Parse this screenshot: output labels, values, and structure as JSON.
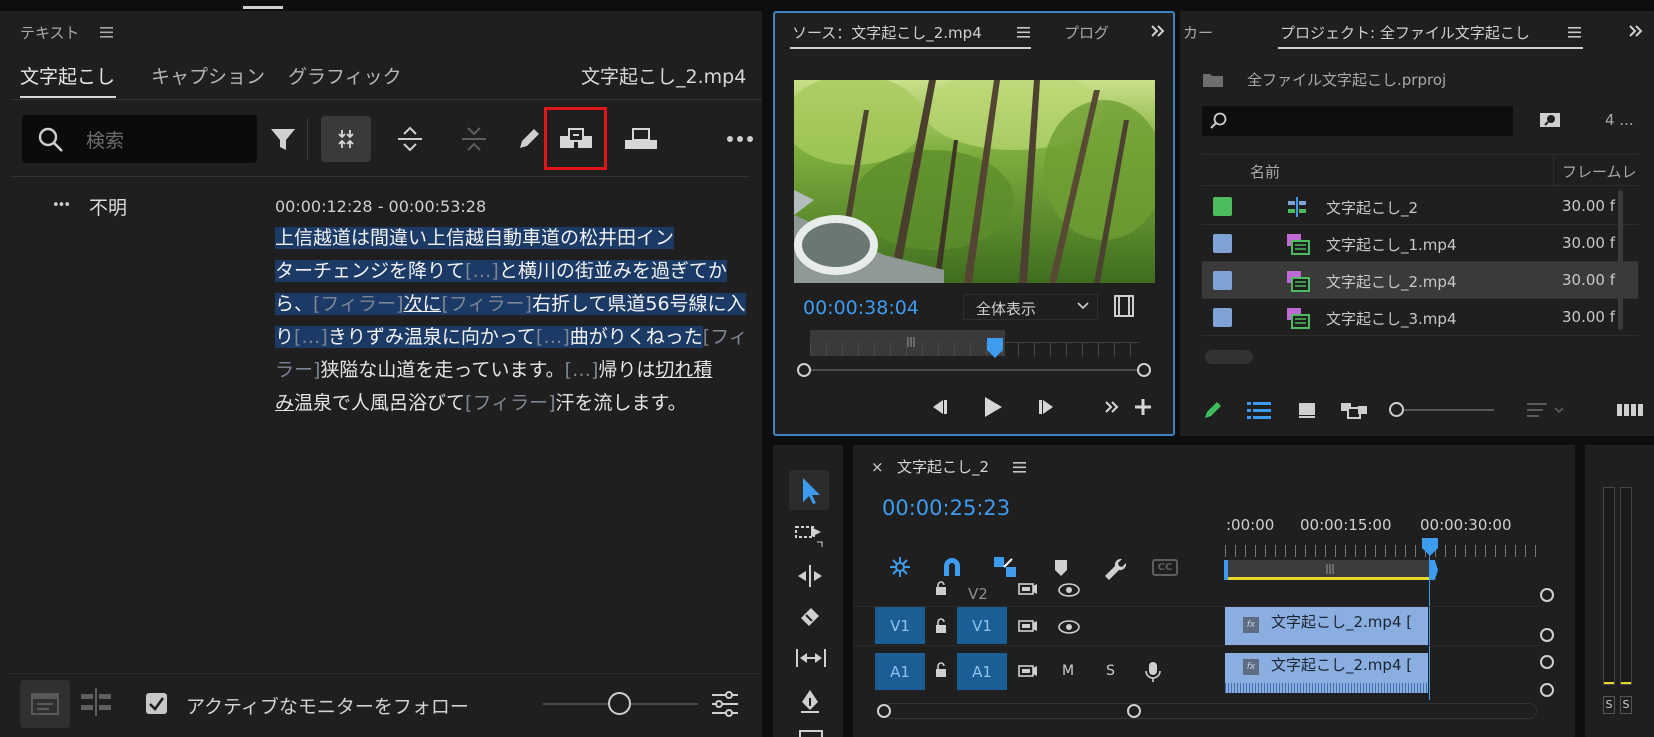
{
  "text_panel": {
    "title": "テキスト",
    "menu_icon": "hamburger-menu-icon",
    "tabs": [
      {
        "label": "文字起こし",
        "active": true
      },
      {
        "label": "キャプション",
        "active": false
      },
      {
        "label": "グラフィック",
        "active": false
      }
    ],
    "file_name": "文字起こし_2.mp4",
    "search_placeholder": "検索",
    "toolbar_icons": [
      "filter-icon",
      "merge-segments-icon",
      "expand-segments-icon",
      "collapse-segments-icon",
      "edit-pencil-icon",
      "extract-icon",
      "lift-icon",
      "more-options-icon"
    ],
    "speaker_dots": "•••",
    "speaker": "不明",
    "timecode": "00:00:12:28 - 00:00:53:28",
    "footer_checkbox_label": "アクティブなモニターをフォロー",
    "footer_checkbox_checked": true,
    "highlight_color": "#1b3a66",
    "annotation_color": "#e0161b"
  },
  "transcript_lines": [
    {
      "segments": [
        {
          "t": "上信越道は間違い上信越自動車道の松井田イン",
          "c": "hl"
        }
      ]
    },
    {
      "segments": [
        {
          "t": "ターチェンジを降りて",
          "c": "hl"
        },
        {
          "t": "[…]",
          "c": "hl dim"
        },
        {
          "t": "と横川の街並みを過ぎてか",
          "c": "hl"
        }
      ]
    },
    {
      "segments": [
        {
          "t": "ら、",
          "c": "hl"
        },
        {
          "t": "[フィラー]",
          "c": "hl dim"
        },
        {
          "t": "次に",
          "c": "hl u"
        },
        {
          "t": "[フィラー]",
          "c": "hl dim"
        },
        {
          "t": "右折して県道56号線に入",
          "c": "hl"
        }
      ]
    },
    {
      "segments": [
        {
          "t": "り",
          "c": "hl"
        },
        {
          "t": "[…]",
          "c": "hl dim"
        },
        {
          "t": "きりずみ温泉に向かって",
          "c": "hl"
        },
        {
          "t": "[…]",
          "c": "hl dim"
        },
        {
          "t": "曲がりくねった",
          "c": "hl"
        },
        {
          "t": "[フィ",
          "c": "dim"
        }
      ]
    },
    {
      "segments": [
        {
          "t": "ラー]",
          "c": "dim"
        },
        {
          "t": "狭隘な山道を走っています。",
          "c": ""
        },
        {
          "t": "[…]",
          "c": "dim"
        },
        {
          "t": "帰りは",
          "c": ""
        },
        {
          "t": "切れ積",
          "c": "u"
        }
      ]
    },
    {
      "segments": [
        {
          "t": "み",
          "c": "u"
        },
        {
          "t": "温泉で人風呂浴びて",
          "c": ""
        },
        {
          "t": "[フィラー]",
          "c": "dim"
        },
        {
          "t": "汗を流します。",
          "c": ""
        }
      ]
    }
  ],
  "source_monitor": {
    "tab_label": "ソース：文字起こし_2.mp4",
    "tab2_label": "プログ",
    "timecode": "00:00:38:04",
    "zoom_select": "全体表示",
    "playhead_fraction": 0.56,
    "accent": "#3d9cf0"
  },
  "project_panel": {
    "tab_prev_label": "カー",
    "tab_label": "プロジェクト: 全ファイル文字起こし",
    "project_file": "全ファイル文字起こし.prproj",
    "item_count": "4 ...",
    "col_name": "名前",
    "col_rate": "フレームレ",
    "items": [
      {
        "name": "文字起こし_2",
        "rate": "30.00 f",
        "color": "#4dbb5f",
        "icon": "sequence-icon"
      },
      {
        "name": "文字起こし_1.mp4",
        "rate": "30.00 f",
        "color": "#7fa3d6",
        "icon": "video-clip-icon"
      },
      {
        "name": "文字起こし_2.mp4",
        "rate": "30.00 f",
        "color": "#7fa3d6",
        "icon": "video-clip-icon",
        "selected": true
      },
      {
        "name": "文字起こし_3.mp4",
        "rate": "30.00 f",
        "color": "#7fa3d6",
        "icon": "video-clip-icon"
      }
    ]
  },
  "timeline": {
    "close": "×",
    "title": "文字起こし_2",
    "timecode": "00:00:25:23",
    "ruler_labels": [
      ":00:00",
      "00:00:15:00",
      "00:00:30:00"
    ],
    "tracks": {
      "v2": "V2",
      "v1_src": "V1",
      "v1": "V1",
      "a1_src": "A1",
      "a1": "A1",
      "mute": "M",
      "solo": "S"
    },
    "clip_video": "文字起こし_2.mp4 [",
    "clip_audio": "文字起こし_2.mp4 [",
    "fx": "fx",
    "cc": "CC"
  },
  "meters": {
    "s1": "S",
    "s2": "S"
  }
}
